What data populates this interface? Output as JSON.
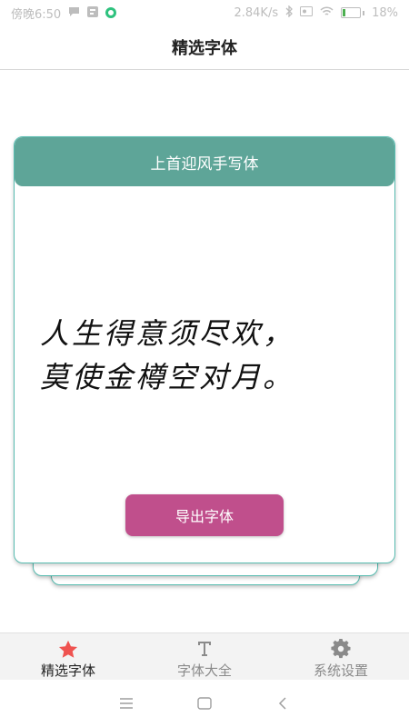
{
  "status_bar": {
    "time": "傍晚6:50",
    "network_speed": "2.84K/s",
    "battery_percent": "18%",
    "battery_level": 0.18,
    "left_icons": [
      "chat-bubble-icon",
      "notification-icon",
      "app-icon"
    ],
    "right_icons": [
      "bluetooth-icon",
      "sim-icon",
      "wifi-icon",
      "battery-icon"
    ]
  },
  "header": {
    "title": "精选字体"
  },
  "font_card": {
    "font_name": "上首迎风手写体",
    "sample_lines": [
      "人生得意须尽欢，",
      "莫使金樽空对月。"
    ],
    "export_label": "导出字体",
    "colors": {
      "header": "#5ea598",
      "border": "#57bcb0",
      "button": "#c04f8c"
    }
  },
  "tabs": [
    {
      "label": "精选字体",
      "icon": "star-icon",
      "active": true
    },
    {
      "label": "字体大全",
      "icon": "font-icon",
      "active": false
    },
    {
      "label": "系统设置",
      "icon": "gear-icon",
      "active": false
    }
  ],
  "colors": {
    "active_tab_icon": "#ef5350",
    "inactive": "#8a8a8a"
  },
  "nav_bar": {
    "buttons": [
      "menu-icon",
      "home-icon",
      "back-icon"
    ]
  }
}
